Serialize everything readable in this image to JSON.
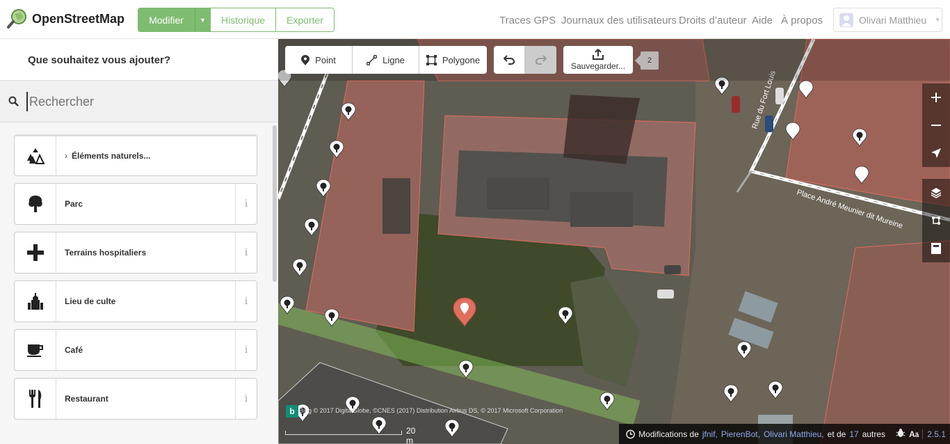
{
  "app": {
    "logo_text": "OpenStreetMap",
    "brand_color": "#7ebc6f"
  },
  "nav": {
    "edit_label": "Modifier",
    "history_label": "Historique",
    "export_label": "Exporter",
    "links": [
      "Traces GPS",
      "Journaux des utilisateurs",
      "Droits d’auteur",
      "Aide",
      "À propos"
    ],
    "user_name": "Olivari Matthieu"
  },
  "sidebar": {
    "title": "Que souhaitez vous ajouter?",
    "search_placeholder": "Rechercher",
    "presets": [
      {
        "label": "Éléments naturels...",
        "icon": "natural-features-icon",
        "category": true
      },
      {
        "label": "Parc",
        "icon": "tree-icon"
      },
      {
        "label": "Terrains hospitaliers",
        "icon": "plus-icon"
      },
      {
        "label": "Lieu de culte",
        "icon": "place-of-worship-icon"
      },
      {
        "label": "Café",
        "icon": "coffee-cup-icon"
      },
      {
        "label": "Restaurant",
        "icon": "fork-knife-icon"
      }
    ]
  },
  "toolbar": {
    "point_label": "Point",
    "line_label": "Ligne",
    "polygon_label": "Polygone",
    "save_label": "Sauvegarder...",
    "save_count": "2"
  },
  "map": {
    "street_name_1": "Rue du Fort Louis",
    "street_name_2": "Place André Meunier dit Mureine",
    "attribution": "Bing  © 2017 DigitalGlobe, ©CNES (2017) Distribution Airbus DS, © 2017 Microsoft Corporation",
    "scale_label": "20 m",
    "modified_by_prefix": "Modifications de",
    "contributors": [
      "jfnif,",
      "PierenBot,",
      "Olivari Matthieu,"
    ],
    "and_text": "et de",
    "others_count": "17",
    "others_text": "autres",
    "version": "2.5.1",
    "selected_pin_color": "#e06e5f",
    "building_color": "#e06e5f",
    "park_color": "#8cd05f"
  }
}
